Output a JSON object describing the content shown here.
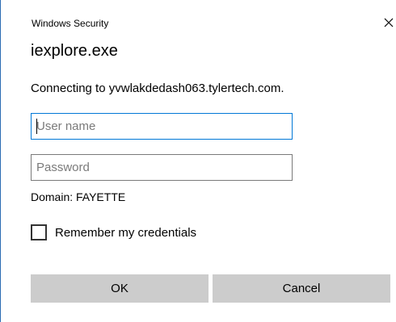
{
  "window": {
    "title": "Windows Security",
    "close_icon": "close-icon"
  },
  "app": {
    "name": "iexplore.exe"
  },
  "message": "Connecting to yvwlakdedash063.tylertech.com.",
  "fields": {
    "username_placeholder": "User name",
    "username_value": "",
    "password_placeholder": "Password",
    "password_value": ""
  },
  "domain": "Domain: FAYETTE",
  "remember": {
    "label": "Remember my credentials",
    "checked": false
  },
  "buttons": {
    "ok": "OK",
    "cancel": "Cancel"
  },
  "colors": {
    "focus_border": "#0078d7",
    "button_bg": "#cccccc",
    "window_accent": "#2b6cb3"
  }
}
